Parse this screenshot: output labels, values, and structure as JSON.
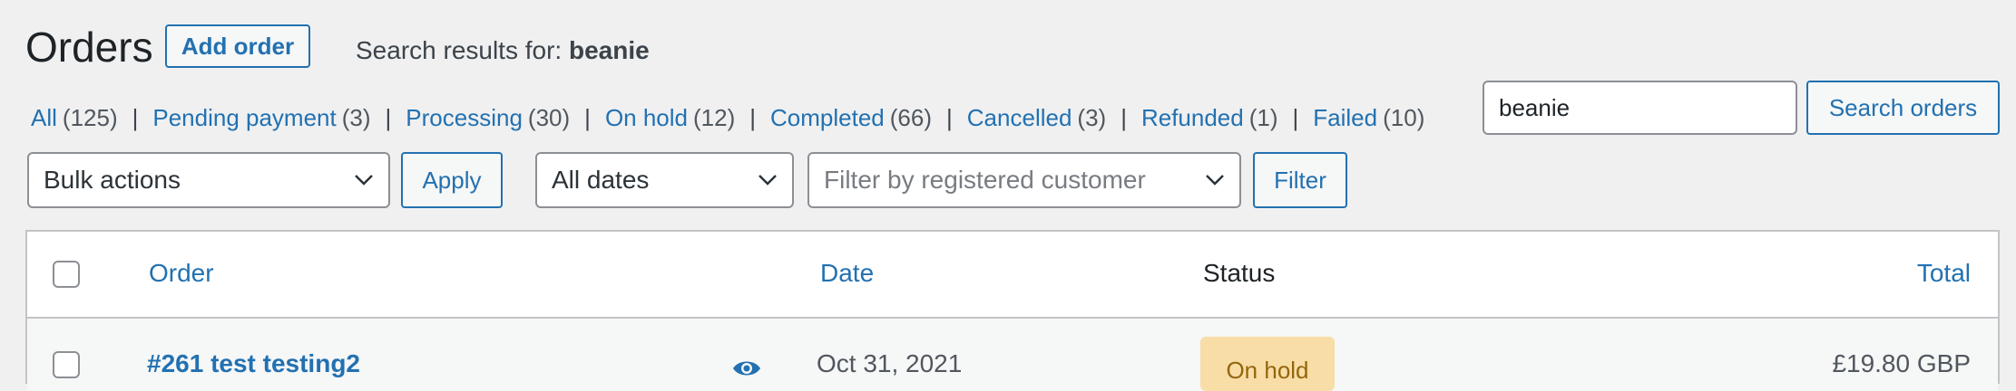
{
  "header": {
    "title": "Orders",
    "add_order_label": "Add order",
    "search_prefix": "Search results for: ",
    "search_term": "beanie"
  },
  "status_filters": [
    {
      "label": "All",
      "count": "(125)"
    },
    {
      "label": "Pending payment",
      "count": "(3)"
    },
    {
      "label": "Processing",
      "count": "(30)"
    },
    {
      "label": "On hold",
      "count": "(12)"
    },
    {
      "label": "Completed",
      "count": "(66)"
    },
    {
      "label": "Cancelled",
      "count": "(3)"
    },
    {
      "label": "Refunded",
      "count": "(1)"
    },
    {
      "label": "Failed",
      "count": "(10)"
    }
  ],
  "search": {
    "value": "beanie",
    "button_label": "Search orders"
  },
  "toolbar": {
    "bulk_actions": "Bulk actions",
    "apply_label": "Apply",
    "dates": "All dates",
    "customer_placeholder": "Filter by registered customer",
    "filter_label": "Filter"
  },
  "table": {
    "columns": {
      "order": "Order",
      "date": "Date",
      "status": "Status",
      "total": "Total"
    },
    "rows": [
      {
        "order": "#261 test testing2",
        "date": "Oct 31, 2021",
        "status": "On hold",
        "total": "£19.80 GBP"
      }
    ]
  },
  "colors": {
    "accent": "#2271b1",
    "background": "#f0f0f1",
    "on_hold_bg": "#f8dda7",
    "on_hold_text": "#94660c"
  },
  "icons": {
    "select_arrow": "chevron-down-icon",
    "preview": "eye-icon"
  }
}
